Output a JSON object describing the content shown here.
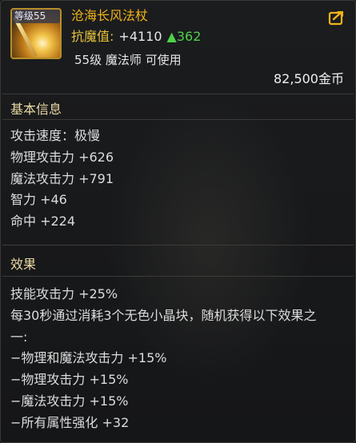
{
  "item": {
    "level_badge": "等级55",
    "name": "沧海长风法杖",
    "resist_label": "抗魔值:",
    "resist_value": "+4110",
    "resist_up": "▲362",
    "requirement": "55级 魔法师 可使用",
    "price": "82,500金币"
  },
  "basic": {
    "title": "基本信息",
    "lines": [
      "攻击速度：极慢",
      "物理攻击力 +626",
      "魔法攻击力 +791",
      "智力 +46",
      "命中 +224"
    ]
  },
  "effects": {
    "title": "效果",
    "lines": [
      "技能攻击力 +25%",
      "每30秒通过消耗3个无色小晶块，随机获得以下效果之",
      "一:",
      "−物理和魔法攻击力 +15%",
      "−物理攻击力 +15%",
      "−魔法攻击力 +15%",
      "−所有属性强化 +32"
    ]
  },
  "colors": {
    "name": "#f0b418",
    "resist_label": "#e7c23a",
    "increase": "#4fd04a",
    "section_title": "#e9d9a2"
  },
  "icons": {
    "share": "share-export-icon",
    "item": "staff-item-icon"
  }
}
